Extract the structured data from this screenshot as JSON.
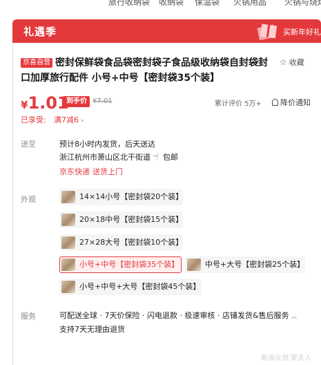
{
  "top_nav": [
    "旅行收纳袋",
    "收纳袋",
    "保温袋",
    "火锅用品",
    "火锅与烧烤"
  ],
  "banner": {
    "title": "礼遇季",
    "right_text": "买新年好礼"
  },
  "product": {
    "tag": "京喜自营",
    "title": "密封保鲜袋食品袋密封袋子食品级收纳袋自封袋封口加厚旅行配件 小号+中号【密封袋35个装】",
    "favorite_label": "收藏"
  },
  "price": {
    "currency": "¥",
    "value": "1.01",
    "badge": "到手价",
    "original": "¥7.01",
    "reviews": "累计评价 5万+",
    "notify": "降价通知"
  },
  "promo": {
    "label": "已享受:",
    "value": "满7减6"
  },
  "delivery": {
    "label": "送至",
    "eta": "预计8小时内发货，后天送达",
    "address": "浙江杭州市萧山区北干街道",
    "shipping_note": "包邮",
    "express": "京东快递",
    "express_note": "送货上门"
  },
  "variants": {
    "label": "外观",
    "options": [
      {
        "label": "14×14小号【密封袋20个装】",
        "selected": false
      },
      {
        "label": "20×18中号【密封袋15个装】",
        "selected": false
      },
      {
        "label": "27×28大号【密封袋10个装】",
        "selected": false
      },
      {
        "label": "小号+中号【密封袋35个装】",
        "selected": true
      },
      {
        "label": "中号+大号【密封袋25个装】",
        "selected": false
      },
      {
        "label": "小号+中号+大号【密封袋45个装】",
        "selected": false
      }
    ]
  },
  "services": {
    "label": "服务",
    "line1": "可配送全球 · 7天价保险 · 闪电退款 · 极速审核 · 店铺发货&售后服务",
    "line2": "支持7天无理由退货"
  },
  "watermark": "新浪众测 家夫人",
  "colors": {
    "accent": "#e4393c",
    "label_gray": "#888888"
  }
}
